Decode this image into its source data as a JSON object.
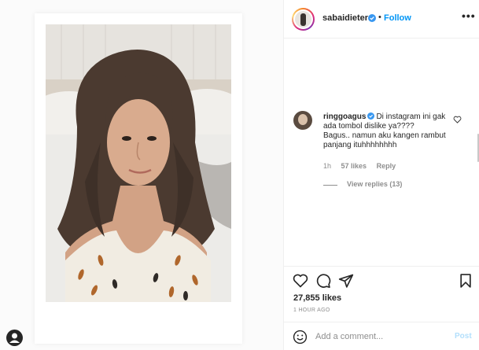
{
  "post": {
    "username": "sabaidieter",
    "follow_label": "Follow",
    "separator": "•",
    "more_label": "•••",
    "likes_count": "27,855 likes",
    "time_ago": "1 HOUR AGO"
  },
  "comment": {
    "username": "ringgoagus",
    "text_line1": "Di instagram ini gak ada tombol dislike ya????",
    "text_line2": "Bagus.. namun aku kangen rambut panjang ituhhhhhhhh",
    "time": "1h",
    "likes": "57 likes",
    "reply_label": "Reply",
    "view_replies": "View replies (13)"
  },
  "composer": {
    "placeholder": "Add a comment...",
    "post_label": "Post"
  },
  "icons": {
    "like": "heart-icon",
    "comment": "comment-bubble-icon",
    "share": "paper-plane-icon",
    "save": "bookmark-icon",
    "emoji": "smiley-icon",
    "verified": "verified-badge-icon"
  },
  "colors": {
    "accent": "#0095f6",
    "secondary_text": "#8e8e8e",
    "border": "#efefef",
    "verified": "#3897f0"
  }
}
